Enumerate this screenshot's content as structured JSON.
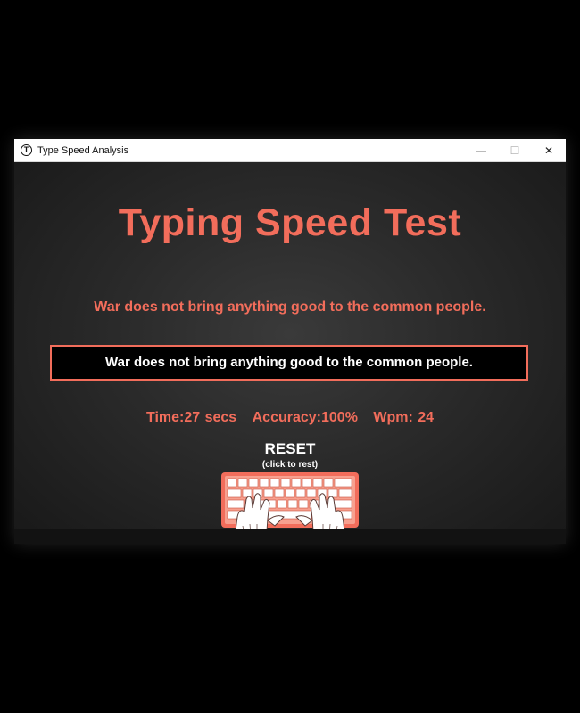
{
  "window": {
    "title": "Type Speed Analysis",
    "icon": "T",
    "controls": {
      "minimize": "—",
      "maximize": "☐",
      "close": "✕"
    }
  },
  "main": {
    "heading": "Typing Speed Test",
    "prompt_sentence": "War does not bring anything good to the common people.",
    "entry_value": "War does not bring anything good to the common people.",
    "stats": {
      "time": "Time:27 secs",
      "accuracy": "Accuracy:100%",
      "wpm": "Wpm: 24"
    },
    "reset": {
      "label": "RESET",
      "sublabel": "(click to rest)"
    }
  },
  "colors": {
    "accent": "#f26d5b",
    "background": "#2a2a2a",
    "entry_bg": "#000000"
  }
}
